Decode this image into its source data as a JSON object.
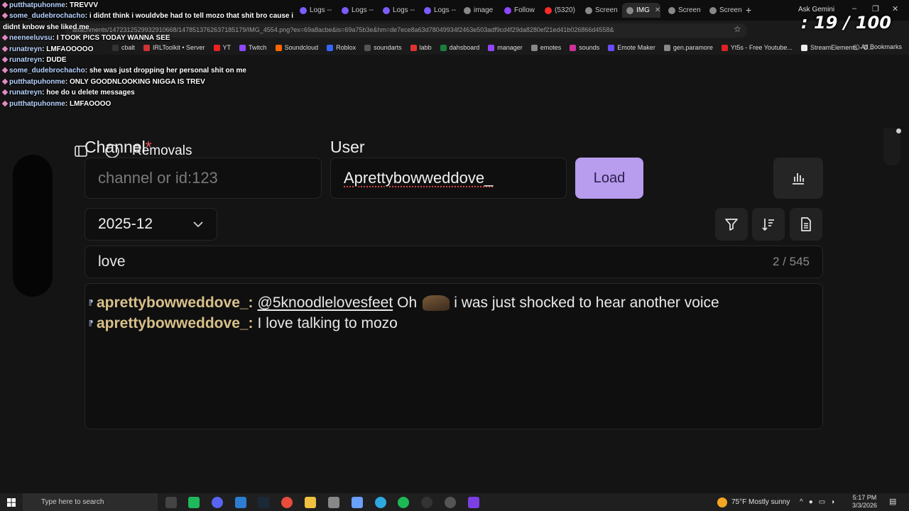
{
  "browser": {
    "tabs": [
      {
        "label": "Logs --",
        "fav": "#7b5cff"
      },
      {
        "label": "Logs --",
        "fav": "#7b5cff"
      },
      {
        "label": "Logs --",
        "fav": "#7b5cff"
      },
      {
        "label": "Logs --",
        "fav": "#7b5cff"
      },
      {
        "label": "image",
        "fav": "#888888"
      },
      {
        "label": "Follow",
        "fav": "#9146ff"
      },
      {
        "label": "(5320)",
        "fav": "#ff2a2a"
      },
      {
        "label": "Screen",
        "fav": "#888888"
      },
      {
        "label": "IMG",
        "fav": "#888888"
      },
      {
        "label": "Screen",
        "fav": "#888888"
      },
      {
        "label": "Screen",
        "fav": "#888888"
      }
    ],
    "ask_gemini": "Ask Gemini",
    "url": "attachments/1472312529932910668/1478513762637185179/IMG_4554.png?ex=69a8acbe&is=69a75b3e&hm=de7ece8a63d78049934f2463e503adf9cd4f29da8280ef21ed41b026866d4558&",
    "bookmarks": [
      {
        "label": "cbalt",
        "color": "#333333"
      },
      {
        "label": "IRLToolkit • Server",
        "color": "#c33"
      },
      {
        "label": "YT",
        "color": "#e22"
      },
      {
        "label": "Twitch",
        "color": "#9146ff"
      },
      {
        "label": "Soundcloud",
        "color": "#f60"
      },
      {
        "label": "Roblox",
        "color": "#3366ff"
      },
      {
        "label": "soundarts",
        "color": "#555555"
      },
      {
        "label": "labb",
        "color": "#d33"
      },
      {
        "label": "dahsboard",
        "color": "#1a7f3c"
      },
      {
        "label": "manager",
        "color": "#9146ff"
      },
      {
        "label": "emotes",
        "color": "#888888"
      },
      {
        "label": "sounds",
        "color": "#c39"
      },
      {
        "label": "Emote Maker",
        "color": "#6a4cff"
      },
      {
        "label": "gen.paramore",
        "color": "#888888"
      },
      {
        "label": "Yt5s - Free Youtube...",
        "color": "#d22"
      },
      {
        "label": "StreamElements - O...",
        "color": "#eeeeee"
      }
    ],
    "all_bookmarks": "All Bookmarks"
  },
  "overlay": {
    "counter": "19 / 100",
    "chat": [
      {
        "user": "putthatpuhonme",
        "text": "TREVVV"
      },
      {
        "user": "some_dudebrochacho",
        "text": "i didnt think i wouldvbe had to tell mozo that shit bro cause i didnt knbow she liked me"
      },
      {
        "user": "neeneeluvsu",
        "text": "I TOOK PICS TODAY WANNA SEE"
      },
      {
        "user": "runatreyn",
        "text": "LMFAOOOOO"
      },
      {
        "user": "runatreyn",
        "text": "DUDE"
      },
      {
        "user": "some_dudebrochacho",
        "text": "she was just dropping her personal shit on me"
      },
      {
        "user": "putthatpuhonme",
        "text": "ONLY GOODNLOOKING NIGGA IS TREV"
      },
      {
        "user": "runatreyn",
        "text": "hoe do u delete messages"
      },
      {
        "user": "putthatpuhonme",
        "text": "LMFAOOOO"
      }
    ]
  },
  "app": {
    "channel_label": "Channel",
    "required_mark": "*",
    "removals_label": "Removals",
    "user_label": "User",
    "channel_placeholder": "channel or id:123",
    "user_value": "Aprettybowweddove_",
    "load_label": "Load",
    "month_value": "2025-12",
    "search_value": "love",
    "match_count": "2 / 545",
    "messages": [
      {
        "user": "aprettybowweddove_:",
        "mention": "@5knoodlelovesfeet",
        "text_before": "Oh",
        "has_emote": true,
        "text": "i was just shocked to hear another voice"
      },
      {
        "user": "aprettybowweddove_:",
        "mention": "",
        "text_before": "",
        "has_emote": false,
        "text": "I love talking to mozo"
      }
    ]
  },
  "taskbar": {
    "search_placeholder": "Type here to search",
    "weather": "75°F  Mostly sunny",
    "time": "5:17 PM",
    "date": "3/3/2026"
  }
}
